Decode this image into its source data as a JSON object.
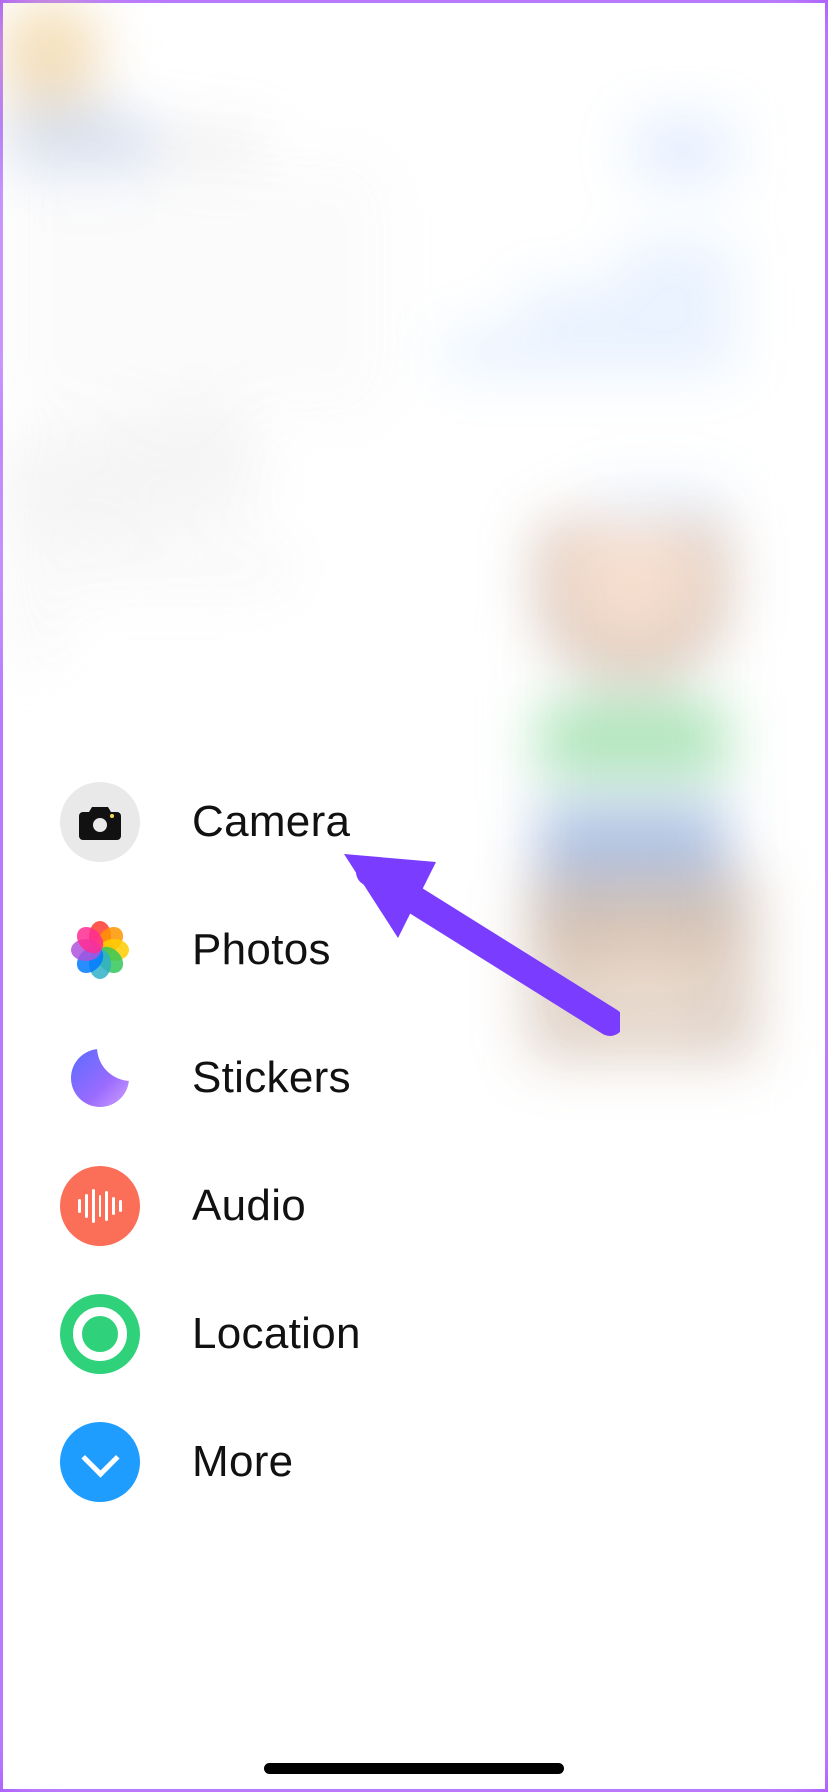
{
  "attachment_menu": {
    "items": [
      {
        "id": "camera",
        "label": "Camera"
      },
      {
        "id": "photos",
        "label": "Photos"
      },
      {
        "id": "stickers",
        "label": "Stickers"
      },
      {
        "id": "audio",
        "label": "Audio"
      },
      {
        "id": "location",
        "label": "Location"
      },
      {
        "id": "more",
        "label": "More"
      }
    ]
  },
  "annotation": {
    "target_item": "camera",
    "arrow_color": "#7a3cff"
  },
  "photos_petal_colors": [
    "#ff3b30",
    "#ff9500",
    "#ffcc00",
    "#34c759",
    "#30b0c7",
    "#007aff",
    "#af52de",
    "#ff2d92"
  ]
}
